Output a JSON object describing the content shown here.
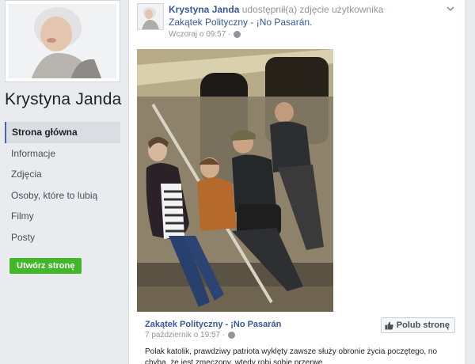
{
  "sidebar": {
    "page_name": "Krystyna Janda",
    "nav": [
      "Strona główna",
      "Informacje",
      "Zdjęcia",
      "Osoby, które to lubią",
      "Filmy",
      "Posty"
    ],
    "create_button": "Utwórz stronę"
  },
  "post": {
    "author": "Krystyna Janda",
    "action": "udostępnił(a) zdjęcie użytkownika",
    "source": "Zakątek Polityczny - ¡No Pasarán.",
    "time": "Wczoraj o 09:57 ·",
    "shared": {
      "page": "Zakątek Polityczny - ¡No Pasarán",
      "time": "7 październik o 19:57 ·",
      "like_button": "Polub stronę",
      "text": "Polak katolik, prawdziwy patriota wyklęty zawsze służy obronie życia poczętego, no chyba, że jest zmęczony, wtedy robi sobie przerwę."
    }
  },
  "colors": {
    "link": "#365899",
    "green": "#42b72a",
    "bg": "#e9ebee"
  }
}
